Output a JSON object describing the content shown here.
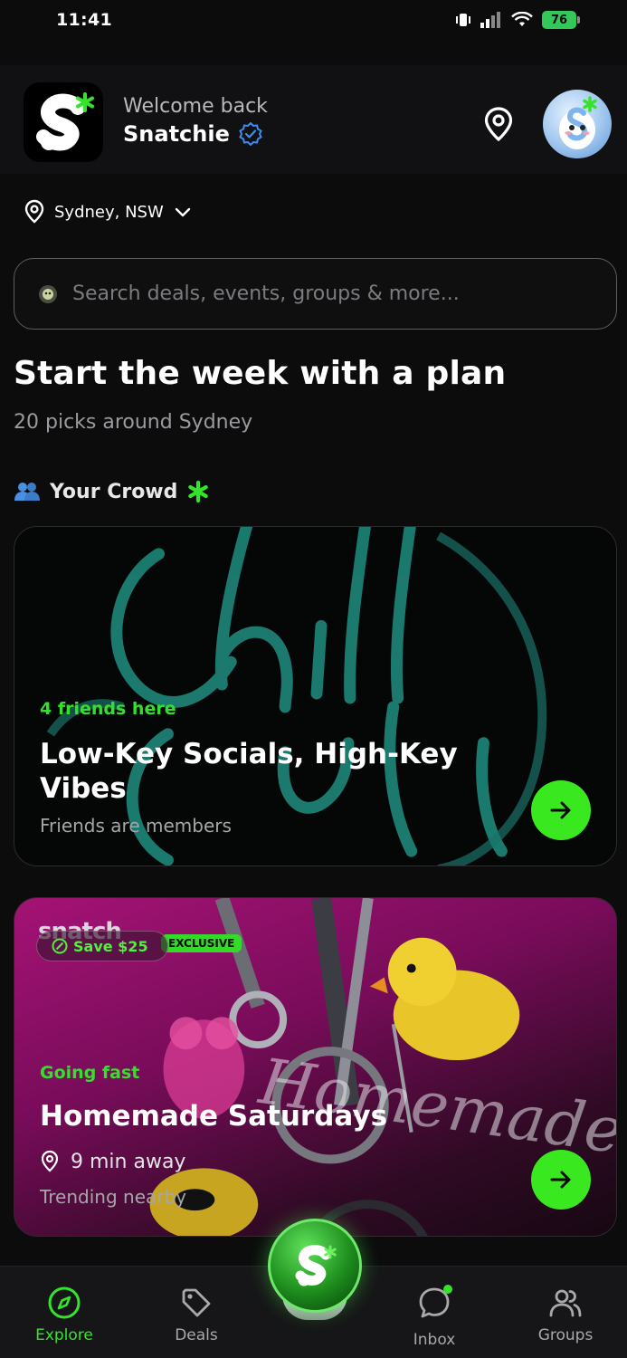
{
  "status_bar": {
    "time": "11:41",
    "battery": "76"
  },
  "header": {
    "welcome": "Welcome back",
    "username": "Snatchie"
  },
  "location": {
    "city": "Sydney, NSW"
  },
  "search": {
    "placeholder": "Search deals, events, groups & more..."
  },
  "section": {
    "title": "Start the week with a plan",
    "subtitle": "20 picks around Sydney",
    "crowd_label": "Your Crowd"
  },
  "cards": [
    {
      "tag": "4 friends here",
      "title": "Low-Key Socials, High-Key Vibes",
      "subtitle": "Friends are members",
      "background_text": "Chill Out"
    },
    {
      "brand": "snatch",
      "exclusive": "EXCLUSIVE",
      "save": "Save $25",
      "tag": "Going fast",
      "title": "Homemade Saturdays",
      "distance": "9 min away",
      "subtitle": "Trending nearby",
      "background_text": "Homemade"
    }
  ],
  "tabs": [
    {
      "label": "Explore",
      "icon": "compass-icon",
      "active": true
    },
    {
      "label": "Deals",
      "icon": "tag-icon",
      "active": false
    },
    {
      "label": "Inbox",
      "icon": "chat-bubble-icon",
      "active": false
    },
    {
      "label": "Groups",
      "icon": "people-icon",
      "active": false
    }
  ],
  "colors": {
    "accent_green": "#36e32b",
    "background": "#0c0c0d",
    "verified_blue": "#3b8ef0"
  }
}
